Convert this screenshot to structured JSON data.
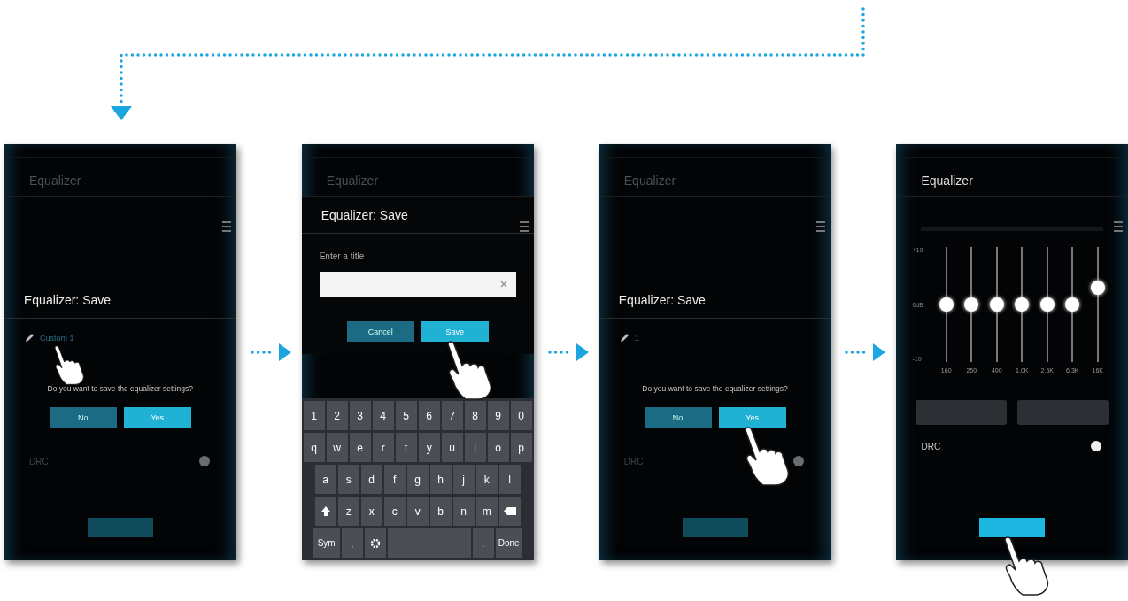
{
  "phones": [
    {
      "kind": "confirm",
      "header": "Equalizer",
      "dialog": {
        "title": "Equalizer: Save",
        "name": "Custom 1",
        "name_touched": true,
        "question": "Do you want to save the equalizer settings?",
        "buttons": [
          {
            "label": "No",
            "primary": false,
            "touched": false
          },
          {
            "label": "Yes",
            "primary": true,
            "touched": false
          }
        ]
      },
      "drc": {
        "label": "DRC",
        "on": true
      }
    },
    {
      "kind": "title_input",
      "header": "Equalizer",
      "dialog": {
        "title": "Equalizer: Save",
        "prompt": "Enter a title",
        "buttons": [
          {
            "label": "Cancel",
            "primary": false,
            "touched": false
          },
          {
            "label": "Save",
            "primary": true,
            "touched": true
          }
        ]
      },
      "keyboard": {
        "rows": [
          [
            {
              "label": "1"
            },
            {
              "label": "2"
            },
            {
              "label": "3"
            },
            {
              "label": "4"
            },
            {
              "label": "5"
            },
            {
              "label": "6"
            },
            {
              "label": "7"
            },
            {
              "label": "8"
            },
            {
              "label": "9"
            },
            {
              "label": "0"
            }
          ],
          [
            {
              "label": "q"
            },
            {
              "label": "w"
            },
            {
              "label": "e"
            },
            {
              "label": "r"
            },
            {
              "label": "t"
            },
            {
              "label": "y"
            },
            {
              "label": "u"
            },
            {
              "label": "i"
            },
            {
              "label": "o"
            },
            {
              "label": "p"
            }
          ],
          [
            {
              "label": "a"
            },
            {
              "label": "s"
            },
            {
              "label": "d"
            },
            {
              "label": "f"
            },
            {
              "label": "g"
            },
            {
              "label": "h"
            },
            {
              "label": "j"
            },
            {
              "label": "k"
            },
            {
              "label": "l"
            }
          ],
          [
            {
              "kind": "shift"
            },
            {
              "label": "z"
            },
            {
              "label": "x"
            },
            {
              "label": "c"
            },
            {
              "label": "v"
            },
            {
              "label": "b"
            },
            {
              "label": "n"
            },
            {
              "label": "m"
            },
            {
              "kind": "backspace"
            }
          ],
          [
            {
              "label": "Sym",
              "kind": "wide"
            },
            {
              "label": ","
            },
            {
              "kind": "settings"
            },
            {
              "kind": "space"
            },
            {
              "label": "."
            },
            {
              "label": "Done",
              "kind": "wide"
            }
          ]
        ]
      }
    },
    {
      "kind": "confirm",
      "header": "Equalizer",
      "dialog": {
        "title": "Equalizer: Save",
        "name": "1",
        "name_touched": false,
        "question": "Do you want to save the equalizer settings?",
        "buttons": [
          {
            "label": "No",
            "primary": false,
            "touched": false
          },
          {
            "label": "Yes",
            "primary": true,
            "touched": true
          }
        ]
      },
      "drc": {
        "label": "DRC",
        "on": true
      }
    },
    {
      "kind": "equalizer",
      "header": "Equalizer",
      "yticks": [
        "+10",
        "0dB",
        "-10"
      ],
      "bands": [
        {
          "label": "160",
          "level": 0.5
        },
        {
          "label": "250",
          "level": 0.5
        },
        {
          "label": "400",
          "level": 0.5
        },
        {
          "label": "1.0K",
          "level": 0.5
        },
        {
          "label": "2.5K",
          "level": 0.5
        },
        {
          "label": "6.3K",
          "level": 0.5
        },
        {
          "label": "16K",
          "level": 0.65
        }
      ],
      "drc": {
        "label": "DRC",
        "on": true
      },
      "action_touched": true
    }
  ]
}
